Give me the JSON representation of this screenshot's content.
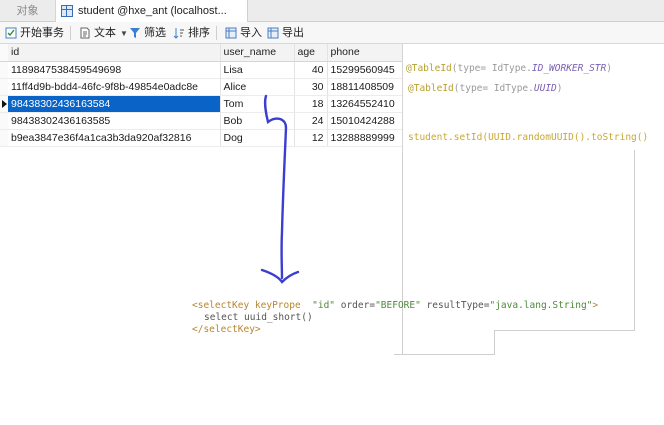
{
  "tabs": {
    "objects": "对象",
    "table": "student @hxe_ant (localhost..."
  },
  "toolbar": {
    "begin_transaction": "开始事务",
    "text": "文本",
    "filter": "筛选",
    "sort": "排序",
    "import": "导入",
    "export": "导出"
  },
  "grid": {
    "columns": [
      "id",
      "user_name",
      "age",
      "phone"
    ],
    "rows": [
      [
        "1189847538459549698",
        "Lisa",
        "40",
        "15299560945"
      ],
      [
        "11ff4d9b-bdd4-46fc-9f8b-49854e0adc8e",
        "Alice",
        "30",
        "18811408509"
      ],
      [
        "984383024361635‍84",
        "Tom",
        "18",
        "13264552410"
      ],
      [
        "98438302436163585",
        "Bob",
        "24",
        "15010424288"
      ],
      [
        "b9ea3847e36f4a1ca3b3da920af32816",
        "Dog",
        "12",
        "13288889999"
      ]
    ]
  },
  "code": {
    "line1_anno": "@TableId",
    "line1_open": "(",
    "line1_type_kw": "type",
    "line1_eq": "= IdType.",
    "line1_const": "ID_WORKER_STR",
    "line1_close": ")",
    "line2_anno": "@TableId",
    "line2_open": "(",
    "line2_type_kw": "type",
    "line2_eq": "= IdType.",
    "line2_const": "UUID",
    "line2_close": ")",
    "line3": "student.setId(UUID.randomUUID().toString()",
    "xml_open_tag": "<selectKey keyPrope",
    "xml_attr1_val": "\"id\"",
    "xml_order": " order=",
    "xml_order_val": "\"BEFORE\"",
    "xml_rt": " resultType=",
    "xml_rt_val": "\"java.lang.String\"",
    "xml_gt": ">",
    "xml_body": "select uuid_short()",
    "xml_close_tag": "</selectKey>"
  },
  "colors": {
    "selection": "#0a64c8",
    "annotation": "#b8a130",
    "pen": "#3a3fd0"
  }
}
